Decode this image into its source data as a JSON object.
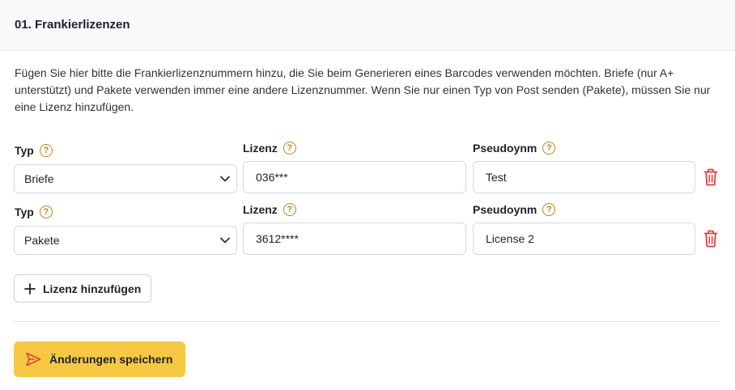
{
  "section": {
    "title": "01. Frankierlizenzen"
  },
  "description": "Fügen Sie hier bitte die Frankierlizenznummern hinzu, die Sie beim Generieren eines Barcodes verwenden möchten. Briefe (nur A+ unterstützt) und Pakete verwenden immer eine andere Lizenznummer. Wenn Sie nur einen Typ von Post senden (Pakete), müssen Sie nur eine Lizenz hinzufügen.",
  "labels": {
    "type": "Typ",
    "license": "Lizenz",
    "pseudonym": "Pseudoynm",
    "help_glyph": "?"
  },
  "rows": [
    {
      "type_value": "Briefe",
      "license_value": "036***",
      "pseudonym_value": "Test"
    },
    {
      "type_value": "Pakete",
      "license_value": "3612****",
      "pseudonym_value": "License 2"
    }
  ],
  "actions": {
    "add_license": "Lizenz hinzufügen",
    "save": "Änderungen speichern"
  },
  "colors": {
    "accent": "#f6c843",
    "help": "#b8861b",
    "delete": "#e0413b",
    "header_bg": "#f8f9fb"
  },
  "icons": {
    "help": "question-circle-icon",
    "delete": "trash-icon",
    "dropdown": "chevron-down-icon",
    "add": "plus-icon",
    "save": "send-icon"
  }
}
